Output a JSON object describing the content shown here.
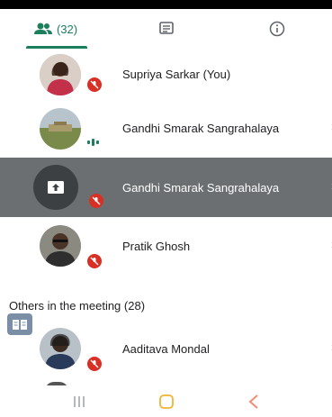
{
  "tabs": {
    "people_count": "(32)",
    "active": "people"
  },
  "participants": [
    {
      "name": "Supriya Sarkar (You)",
      "muted": true,
      "avatar": "photo-woman-red"
    },
    {
      "name": "Gandhi Smarak Sangrahalaya",
      "muted": false,
      "speaking": true,
      "avatar": "photo-field"
    },
    {
      "name": "Gandhi Smarak Sangrahalaya",
      "muted": true,
      "presenting": true,
      "avatar": "present-screen-icon"
    },
    {
      "name": "Pratik Ghosh",
      "muted": true,
      "avatar": "photo-man"
    }
  ],
  "others_section": {
    "label": "Others in the meeting (28)"
  },
  "others": [
    {
      "name": "Aaditava Mondal",
      "muted": true,
      "avatar": "photo-boy"
    }
  ],
  "colors": {
    "accent": "#1a7f5a",
    "mute": "#d93025",
    "present_bg": "#6b6f72"
  }
}
